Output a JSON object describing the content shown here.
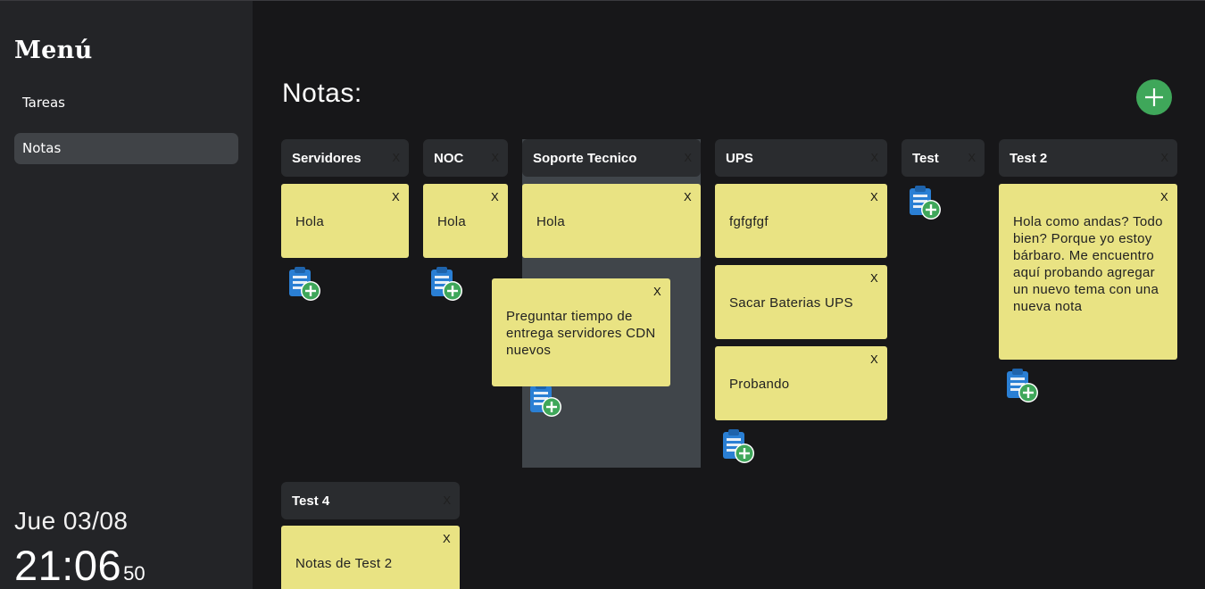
{
  "sidebar": {
    "title": "Menú",
    "items": [
      {
        "label": "Tareas",
        "active": false
      },
      {
        "label": "Notas",
        "active": true
      }
    ],
    "date": "Jue 03/08",
    "time_hm": "21:06",
    "time_sec": "50"
  },
  "main": {
    "title": "Notas:",
    "add_icon": "plus-circle-icon",
    "accent_color": "#3fa75a",
    "note_color": "#e9e383"
  },
  "columns": [
    {
      "title": "Servidores",
      "close": "X",
      "notes": [
        {
          "text": "Hola",
          "close": "X"
        }
      ]
    },
    {
      "title": "NOC",
      "close": "X",
      "notes": [
        {
          "text": "Hola",
          "close": "X"
        }
      ]
    },
    {
      "title": "Soporte Tecnico",
      "close": "X",
      "notes": [
        {
          "text": "Hola",
          "close": "X"
        }
      ]
    },
    {
      "title": "UPS",
      "close": "X",
      "notes": [
        {
          "text": "fgfgfgf",
          "close": "X"
        },
        {
          "text": "Sacar Baterias UPS",
          "close": "X"
        },
        {
          "text": "Probando",
          "close": "X"
        }
      ]
    },
    {
      "title": "Test",
      "close": "X",
      "notes": []
    },
    {
      "title": "Test 2",
      "close": "X",
      "notes": [
        {
          "text": "Hola como andas? Todo bien? Porque yo estoy bárbaro. Me encuentro aquí probando agregar un nuevo tema con una nueva nota",
          "close": "X"
        }
      ]
    },
    {
      "title": "Test 4",
      "close": "X",
      "notes": [
        {
          "text": "Notas de Test 2",
          "close": "X"
        }
      ]
    }
  ],
  "dragging_note": {
    "text": "Preguntar tiempo de entrega servidores CDN nuevos",
    "close": "X"
  }
}
